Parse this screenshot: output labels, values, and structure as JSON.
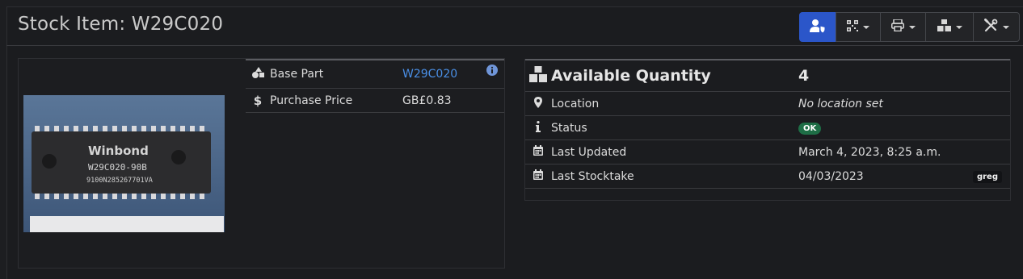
{
  "page": {
    "title": "Stock Item: W29C020"
  },
  "toolbar": {
    "buttons": [
      {
        "icon": "user-shield-icon",
        "style": "primary"
      },
      {
        "icon": "qrcode-icon",
        "dropdown": true
      },
      {
        "icon": "printer-icon",
        "dropdown": true
      },
      {
        "icon": "boxes-icon",
        "dropdown": true
      },
      {
        "icon": "tools-icon",
        "dropdown": true
      }
    ]
  },
  "part_image": {
    "alt": "Winbond W29C020-90B chip",
    "chip_brand": "Winbond",
    "chip_model": "W29C020-90B",
    "chip_serial": "9100N285267701VA"
  },
  "part_info": {
    "rows": [
      {
        "icon": "shapes-icon",
        "label": "Base Part",
        "value": "W29C020",
        "link": true,
        "info": true
      },
      {
        "icon": "dollar-icon",
        "label": "Purchase Price",
        "value": "GB£0.83"
      }
    ]
  },
  "stock_info": {
    "quantity": {
      "label": "Available Quantity",
      "value": "4"
    },
    "rows": [
      {
        "icon": "map-pin-icon",
        "label": "Location",
        "value": "No location set",
        "style": "italic"
      },
      {
        "icon": "info-icon",
        "label": "Status",
        "badge": "OK"
      },
      {
        "icon": "calendar-icon",
        "label": "Last Updated",
        "value": "March 4, 2023, 8:25 a.m."
      },
      {
        "icon": "calendar-icon",
        "label": "Last Stocktake",
        "value": "04/03/2023",
        "user": "greg"
      }
    ]
  },
  "colors": {
    "accent": "#2b56c9",
    "link": "#4a8fe6",
    "badge_ok": "#1e6e46",
    "background": "#1d1e21"
  }
}
